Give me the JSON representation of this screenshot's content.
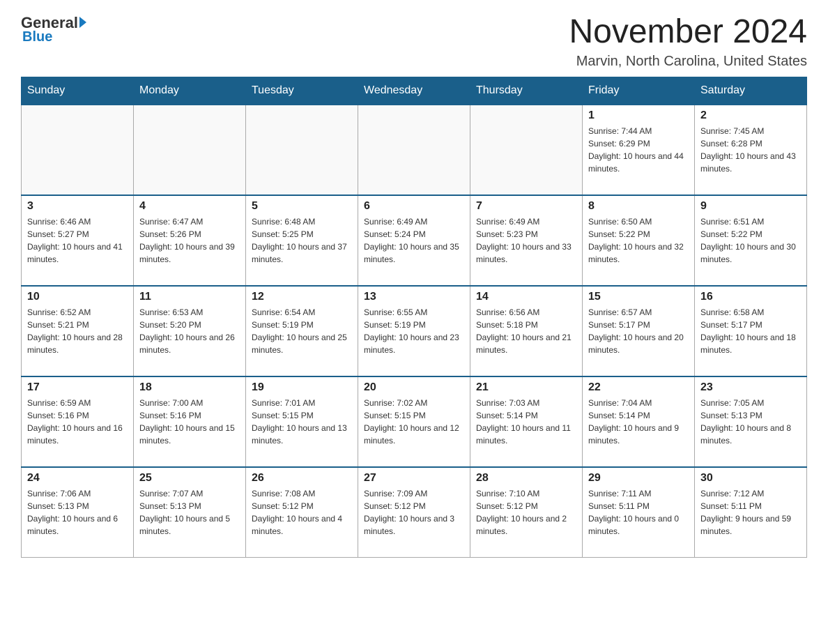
{
  "logo": {
    "general": "General",
    "blue": "Blue",
    "sub": "Blue"
  },
  "title": "November 2024",
  "subtitle": "Marvin, North Carolina, United States",
  "days_of_week": [
    "Sunday",
    "Monday",
    "Tuesday",
    "Wednesday",
    "Thursday",
    "Friday",
    "Saturday"
  ],
  "weeks": [
    [
      {
        "day": "",
        "sunrise": "",
        "sunset": "",
        "daylight": ""
      },
      {
        "day": "",
        "sunrise": "",
        "sunset": "",
        "daylight": ""
      },
      {
        "day": "",
        "sunrise": "",
        "sunset": "",
        "daylight": ""
      },
      {
        "day": "",
        "sunrise": "",
        "sunset": "",
        "daylight": ""
      },
      {
        "day": "",
        "sunrise": "",
        "sunset": "",
        "daylight": ""
      },
      {
        "day": "1",
        "sunrise": "Sunrise: 7:44 AM",
        "sunset": "Sunset: 6:29 PM",
        "daylight": "Daylight: 10 hours and 44 minutes."
      },
      {
        "day": "2",
        "sunrise": "Sunrise: 7:45 AM",
        "sunset": "Sunset: 6:28 PM",
        "daylight": "Daylight: 10 hours and 43 minutes."
      }
    ],
    [
      {
        "day": "3",
        "sunrise": "Sunrise: 6:46 AM",
        "sunset": "Sunset: 5:27 PM",
        "daylight": "Daylight: 10 hours and 41 minutes."
      },
      {
        "day": "4",
        "sunrise": "Sunrise: 6:47 AM",
        "sunset": "Sunset: 5:26 PM",
        "daylight": "Daylight: 10 hours and 39 minutes."
      },
      {
        "day": "5",
        "sunrise": "Sunrise: 6:48 AM",
        "sunset": "Sunset: 5:25 PM",
        "daylight": "Daylight: 10 hours and 37 minutes."
      },
      {
        "day": "6",
        "sunrise": "Sunrise: 6:49 AM",
        "sunset": "Sunset: 5:24 PM",
        "daylight": "Daylight: 10 hours and 35 minutes."
      },
      {
        "day": "7",
        "sunrise": "Sunrise: 6:49 AM",
        "sunset": "Sunset: 5:23 PM",
        "daylight": "Daylight: 10 hours and 33 minutes."
      },
      {
        "day": "8",
        "sunrise": "Sunrise: 6:50 AM",
        "sunset": "Sunset: 5:22 PM",
        "daylight": "Daylight: 10 hours and 32 minutes."
      },
      {
        "day": "9",
        "sunrise": "Sunrise: 6:51 AM",
        "sunset": "Sunset: 5:22 PM",
        "daylight": "Daylight: 10 hours and 30 minutes."
      }
    ],
    [
      {
        "day": "10",
        "sunrise": "Sunrise: 6:52 AM",
        "sunset": "Sunset: 5:21 PM",
        "daylight": "Daylight: 10 hours and 28 minutes."
      },
      {
        "day": "11",
        "sunrise": "Sunrise: 6:53 AM",
        "sunset": "Sunset: 5:20 PM",
        "daylight": "Daylight: 10 hours and 26 minutes."
      },
      {
        "day": "12",
        "sunrise": "Sunrise: 6:54 AM",
        "sunset": "Sunset: 5:19 PM",
        "daylight": "Daylight: 10 hours and 25 minutes."
      },
      {
        "day": "13",
        "sunrise": "Sunrise: 6:55 AM",
        "sunset": "Sunset: 5:19 PM",
        "daylight": "Daylight: 10 hours and 23 minutes."
      },
      {
        "day": "14",
        "sunrise": "Sunrise: 6:56 AM",
        "sunset": "Sunset: 5:18 PM",
        "daylight": "Daylight: 10 hours and 21 minutes."
      },
      {
        "day": "15",
        "sunrise": "Sunrise: 6:57 AM",
        "sunset": "Sunset: 5:17 PM",
        "daylight": "Daylight: 10 hours and 20 minutes."
      },
      {
        "day": "16",
        "sunrise": "Sunrise: 6:58 AM",
        "sunset": "Sunset: 5:17 PM",
        "daylight": "Daylight: 10 hours and 18 minutes."
      }
    ],
    [
      {
        "day": "17",
        "sunrise": "Sunrise: 6:59 AM",
        "sunset": "Sunset: 5:16 PM",
        "daylight": "Daylight: 10 hours and 16 minutes."
      },
      {
        "day": "18",
        "sunrise": "Sunrise: 7:00 AM",
        "sunset": "Sunset: 5:16 PM",
        "daylight": "Daylight: 10 hours and 15 minutes."
      },
      {
        "day": "19",
        "sunrise": "Sunrise: 7:01 AM",
        "sunset": "Sunset: 5:15 PM",
        "daylight": "Daylight: 10 hours and 13 minutes."
      },
      {
        "day": "20",
        "sunrise": "Sunrise: 7:02 AM",
        "sunset": "Sunset: 5:15 PM",
        "daylight": "Daylight: 10 hours and 12 minutes."
      },
      {
        "day": "21",
        "sunrise": "Sunrise: 7:03 AM",
        "sunset": "Sunset: 5:14 PM",
        "daylight": "Daylight: 10 hours and 11 minutes."
      },
      {
        "day": "22",
        "sunrise": "Sunrise: 7:04 AM",
        "sunset": "Sunset: 5:14 PM",
        "daylight": "Daylight: 10 hours and 9 minutes."
      },
      {
        "day": "23",
        "sunrise": "Sunrise: 7:05 AM",
        "sunset": "Sunset: 5:13 PM",
        "daylight": "Daylight: 10 hours and 8 minutes."
      }
    ],
    [
      {
        "day": "24",
        "sunrise": "Sunrise: 7:06 AM",
        "sunset": "Sunset: 5:13 PM",
        "daylight": "Daylight: 10 hours and 6 minutes."
      },
      {
        "day": "25",
        "sunrise": "Sunrise: 7:07 AM",
        "sunset": "Sunset: 5:13 PM",
        "daylight": "Daylight: 10 hours and 5 minutes."
      },
      {
        "day": "26",
        "sunrise": "Sunrise: 7:08 AM",
        "sunset": "Sunset: 5:12 PM",
        "daylight": "Daylight: 10 hours and 4 minutes."
      },
      {
        "day": "27",
        "sunrise": "Sunrise: 7:09 AM",
        "sunset": "Sunset: 5:12 PM",
        "daylight": "Daylight: 10 hours and 3 minutes."
      },
      {
        "day": "28",
        "sunrise": "Sunrise: 7:10 AM",
        "sunset": "Sunset: 5:12 PM",
        "daylight": "Daylight: 10 hours and 2 minutes."
      },
      {
        "day": "29",
        "sunrise": "Sunrise: 7:11 AM",
        "sunset": "Sunset: 5:11 PM",
        "daylight": "Daylight: 10 hours and 0 minutes."
      },
      {
        "day": "30",
        "sunrise": "Sunrise: 7:12 AM",
        "sunset": "Sunset: 5:11 PM",
        "daylight": "Daylight: 9 hours and 59 minutes."
      }
    ]
  ]
}
